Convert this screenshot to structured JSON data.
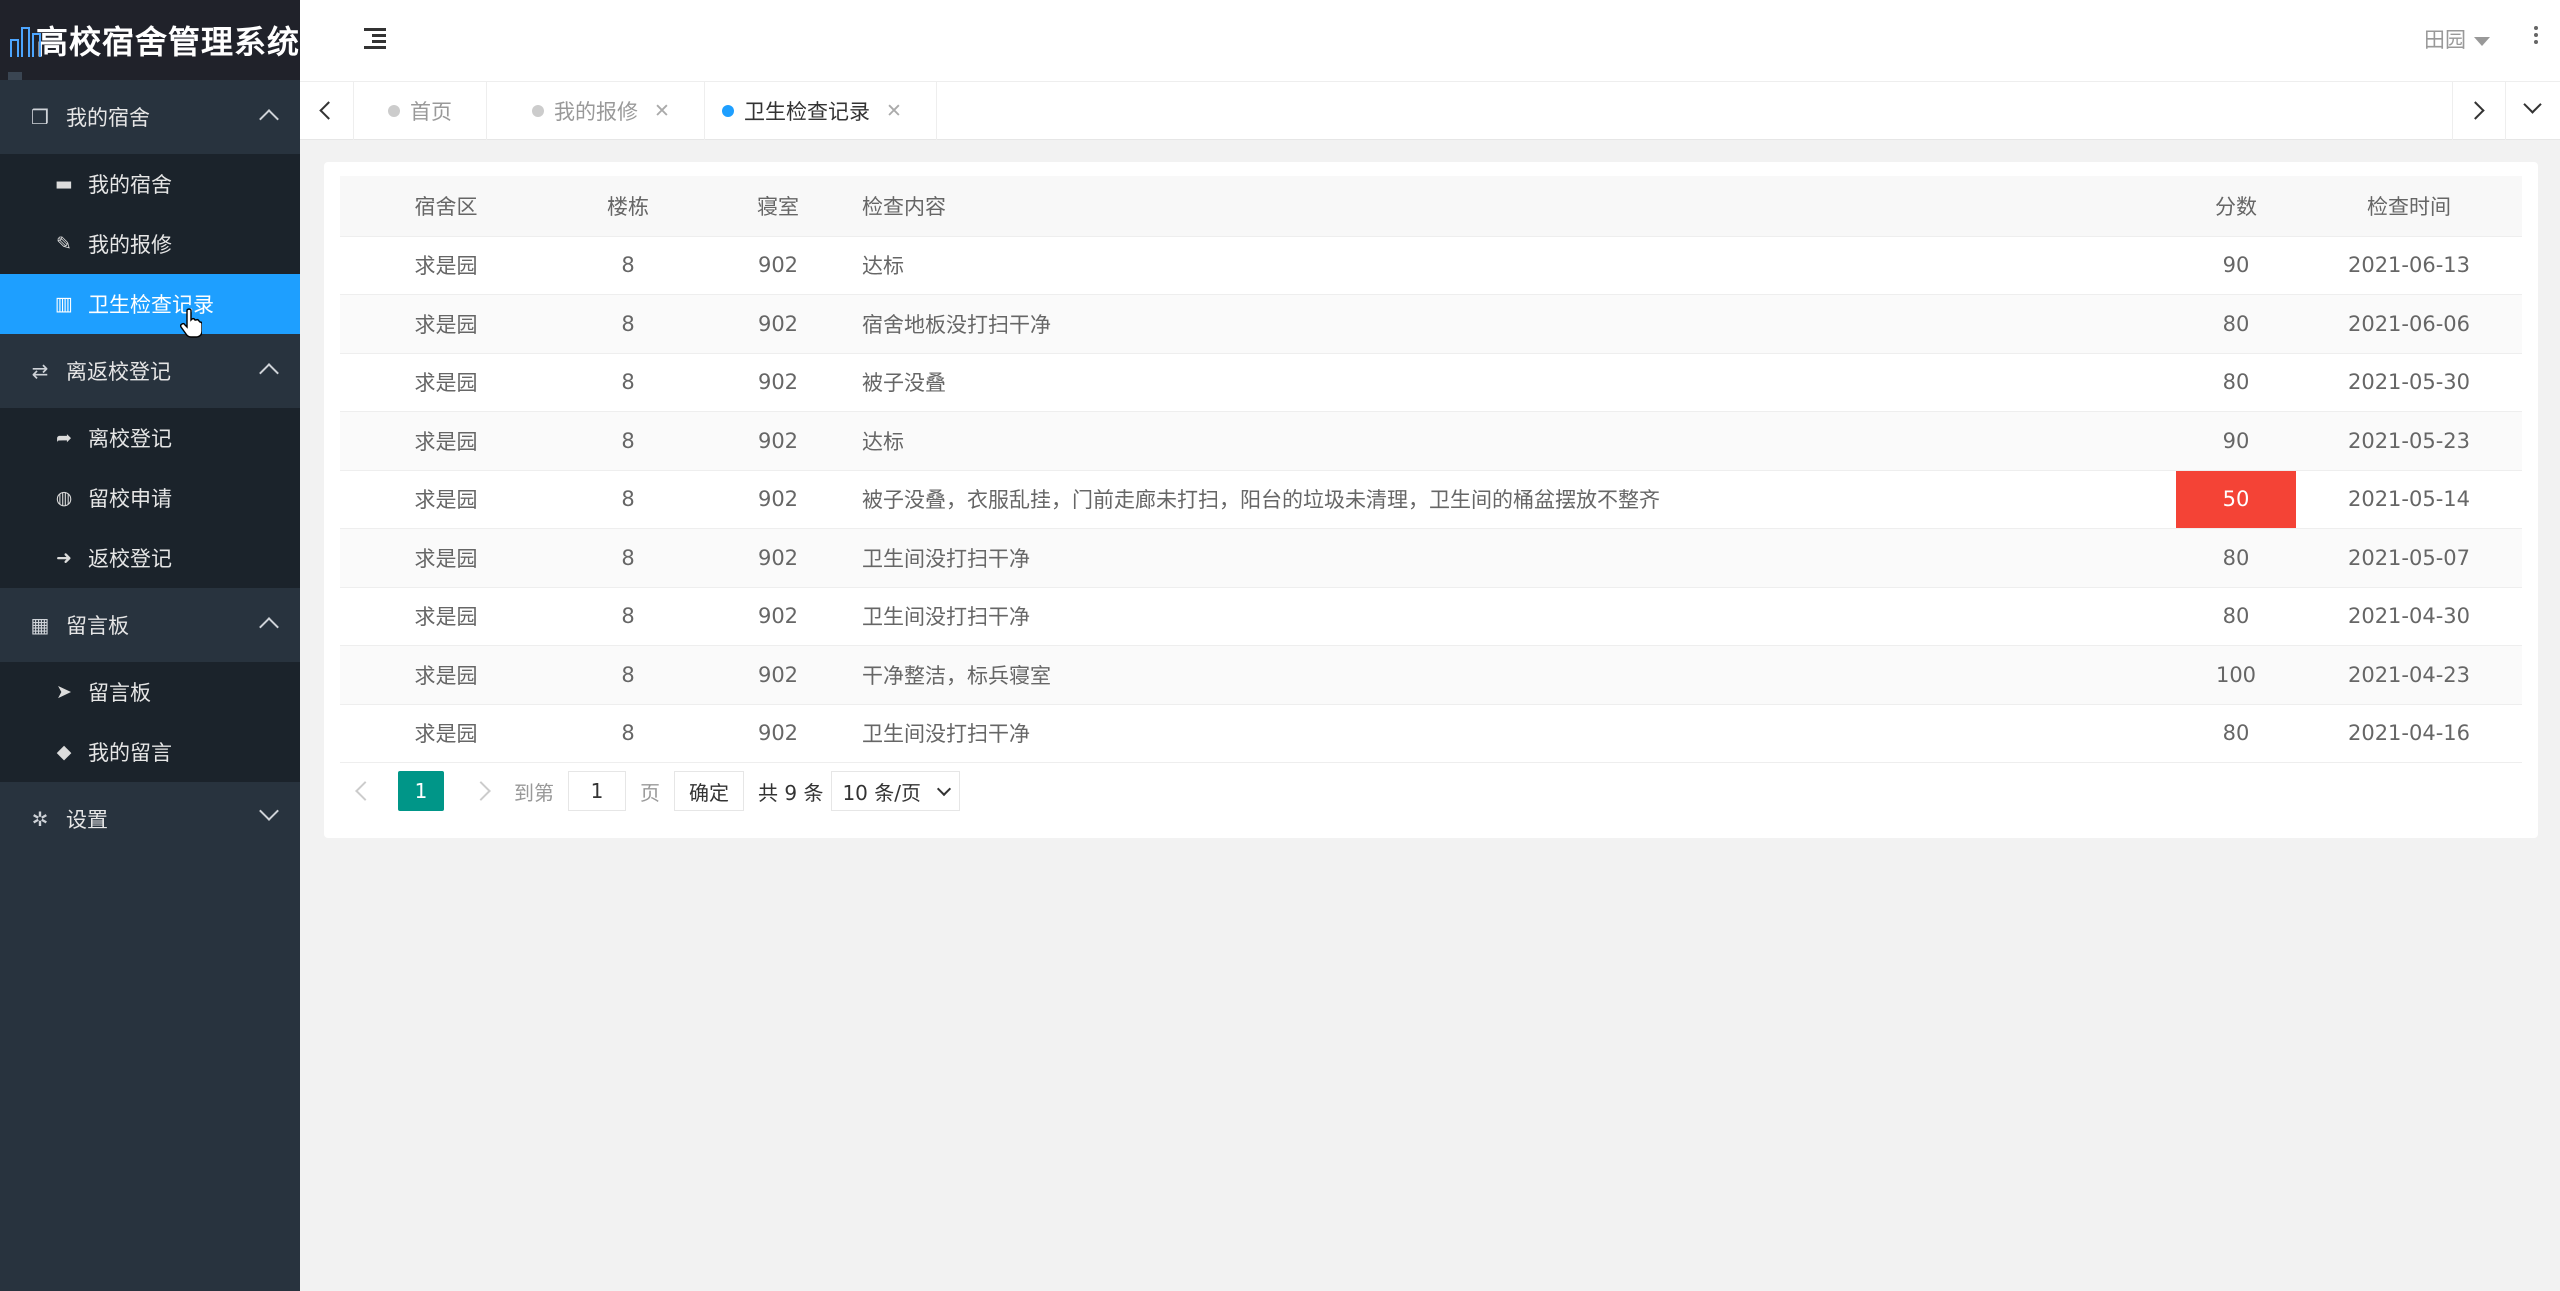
{
  "app": {
    "title": "高校宿舍管理系统"
  },
  "sidebar": {
    "groups": [
      {
        "label": "我的宿舍",
        "icon": "cube-icon",
        "expanded": true,
        "items": [
          {
            "label": "我的宿舍",
            "icon": "bed-icon"
          },
          {
            "label": "我的报修",
            "icon": "wrench-icon"
          },
          {
            "label": "卫生检查记录",
            "icon": "bar-chart-icon",
            "active": true
          }
        ]
      },
      {
        "label": "离返校登记",
        "icon": "exchange-icon",
        "expanded": true,
        "items": [
          {
            "label": "离校登记",
            "icon": "sign-out-icon"
          },
          {
            "label": "留校申请",
            "icon": "globe-icon"
          },
          {
            "label": "返校登记",
            "icon": "sign-in-icon"
          }
        ]
      },
      {
        "label": "留言板",
        "icon": "calendar-icon",
        "expanded": true,
        "items": [
          {
            "label": "留言板",
            "icon": "paper-plane-icon"
          },
          {
            "label": "我的留言",
            "icon": "tags-icon"
          }
        ]
      },
      {
        "label": "设置",
        "icon": "gear-icon",
        "expanded": false,
        "items": []
      }
    ]
  },
  "header": {
    "user": "田园"
  },
  "tabs": [
    {
      "label": "首页",
      "closable": false,
      "active": false
    },
    {
      "label": "我的报修",
      "closable": true,
      "active": false
    },
    {
      "label": "卫生检查记录",
      "closable": true,
      "active": true
    }
  ],
  "table": {
    "columns": [
      "宿舍区",
      "楼栋",
      "寝室",
      "检查内容",
      "分数",
      "检查时间"
    ],
    "rows": [
      [
        "求是园",
        "8",
        "902",
        "达标",
        "90",
        "2021-06-13"
      ],
      [
        "求是园",
        "8",
        "902",
        "宿舍地板没打扫干净",
        "80",
        "2021-06-06"
      ],
      [
        "求是园",
        "8",
        "902",
        "被子没叠",
        "80",
        "2021-05-30"
      ],
      [
        "求是园",
        "8",
        "902",
        "达标",
        "90",
        "2021-05-23"
      ],
      [
        "求是园",
        "8",
        "902",
        "被子没叠，衣服乱挂，门前走廊未打扫，阳台的垃圾未清理，卫生间的桶盆摆放不整齐",
        "50",
        "2021-05-14"
      ],
      [
        "求是园",
        "8",
        "902",
        "卫生间没打扫干净",
        "80",
        "2021-05-07"
      ],
      [
        "求是园",
        "8",
        "902",
        "卫生间没打扫干净",
        "80",
        "2021-04-30"
      ],
      [
        "求是园",
        "8",
        "902",
        "干净整洁，标兵寝室",
        "100",
        "2021-04-23"
      ],
      [
        "求是园",
        "8",
        "902",
        "卫生间没打扫干净",
        "80",
        "2021-04-16"
      ]
    ],
    "low_score_color": "#f44336"
  },
  "pager": {
    "current": "1",
    "goto_label": "到第",
    "goto_value": "1",
    "page_unit": "页",
    "confirm": "确定",
    "total": "共 9 条",
    "page_size": "10 条/页"
  },
  "colors": {
    "accent": "#1e9fff",
    "pager_active": "#009688",
    "sidebar_bg": "#28333e"
  }
}
